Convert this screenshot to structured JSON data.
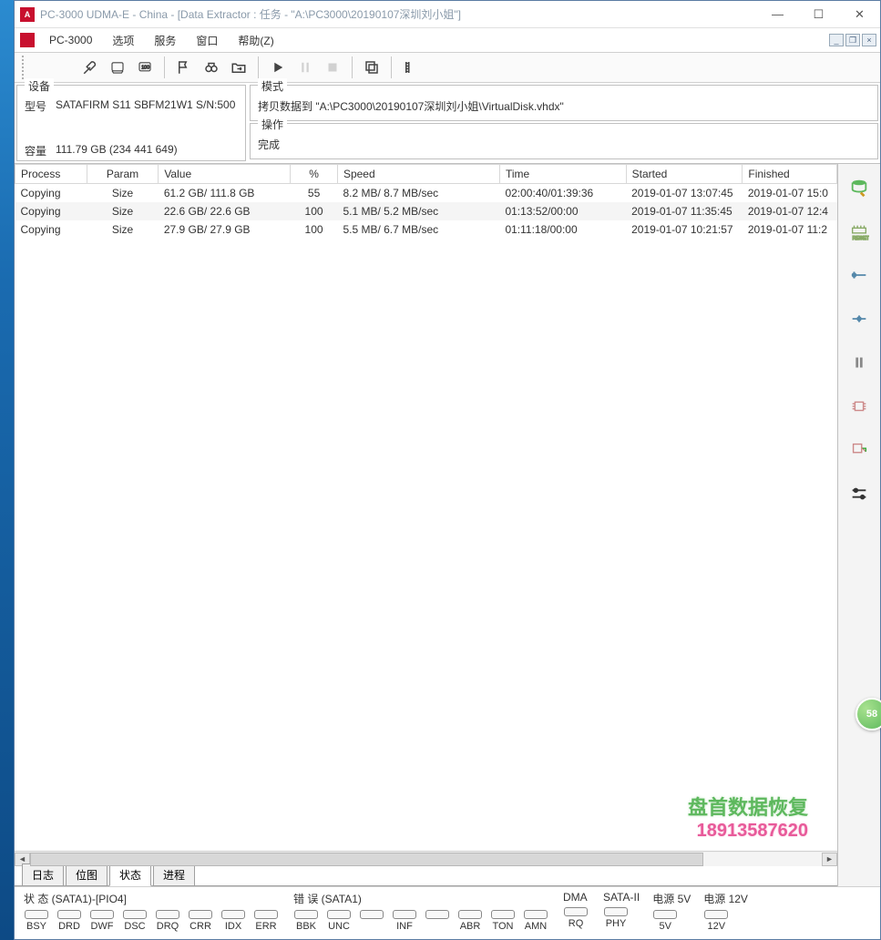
{
  "window": {
    "title": "PC-3000 UDMA-E - China - [Data Extractor : 任务 - \"A:\\PC3000\\20190107深圳刘小姐\"]",
    "app_name": "PC-3000"
  },
  "menu": {
    "items": [
      "PC-3000",
      "选项",
      "服务",
      "窗口",
      "帮助(Z)"
    ]
  },
  "info": {
    "device_legend": "设备",
    "model_label": "型号",
    "model_value": "SATAFIRM   S11 SBFM21W1 S/N:500",
    "capacity_label": "容量",
    "capacity_value": "111.79 GB (234 441 649)",
    "mode_legend": "模式",
    "mode_value": "拷贝数据到 \"A:\\PC3000\\20190107深圳刘小姐\\VirtualDisk.vhdx\"",
    "op_legend": "操作",
    "op_value": "完成"
  },
  "table": {
    "headers": {
      "process": "Process",
      "param": "Param",
      "value": "Value",
      "percent": "%",
      "speed": "Speed",
      "time": "Time",
      "started": "Started",
      "finished": "Finished"
    },
    "rows": [
      {
        "process": "Copying",
        "param": "Size",
        "value": "61.2 GB/ 111.8 GB",
        "percent": "55",
        "speed": "8.2 MB/ 8.7 MB/sec",
        "time": "02:00:40/01:39:36",
        "started": "2019-01-07 13:07:45",
        "finished": "2019-01-07 15:0"
      },
      {
        "process": "Copying",
        "param": "Size",
        "value": "22.6 GB/ 22.6 GB",
        "percent": "100",
        "speed": "5.1 MB/ 5.2 MB/sec",
        "time": "01:13:52/00:00",
        "started": "2019-01-07 11:35:45",
        "finished": "2019-01-07 12:4"
      },
      {
        "process": "Copying",
        "param": "Size",
        "value": "27.9 GB/ 27.9 GB",
        "percent": "100",
        "speed": "5.5 MB/ 6.7 MB/sec",
        "time": "01:11:18/00:00",
        "started": "2019-01-07 10:21:57",
        "finished": "2019-01-07 11:2"
      }
    ]
  },
  "bottom_tabs": [
    "日志",
    "位图",
    "状态",
    "进程"
  ],
  "status": {
    "group1": {
      "title": "状 态 (SATA1)-[PIO4]",
      "leds": [
        "BSY",
        "DRD",
        "DWF",
        "DSC",
        "DRQ",
        "CRR",
        "IDX",
        "ERR"
      ]
    },
    "group2": {
      "title": "错 误 (SATA1)",
      "leds": [
        "BBK",
        "UNC",
        "",
        "INF",
        "",
        "ABR",
        "TON",
        "AMN"
      ]
    },
    "group3": {
      "title": "DMA",
      "leds": [
        "RQ"
      ]
    },
    "group4": {
      "title": "SATA-II",
      "leds": [
        "PHY"
      ]
    },
    "group5": {
      "title": "电源 5V",
      "leds": [
        "5V"
      ]
    },
    "group6": {
      "title": "电源 12V",
      "leds": [
        "12V"
      ]
    }
  },
  "watermark": {
    "line1": "盘首数据恢复",
    "line2": "18913587620"
  },
  "badge": "58"
}
